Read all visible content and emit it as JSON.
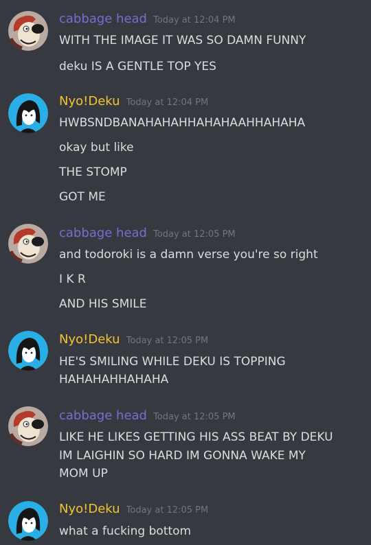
{
  "colors": {
    "background": "#36393f",
    "cabbage_name": "#7d6bd1",
    "deku_name": "#f4c430",
    "timestamp": "#72767d",
    "text": "#dcddde"
  },
  "groups": [
    {
      "author": "cabbage head",
      "avatar": "cartoon-dog-avatar",
      "timestamp": "Today at 12:04 PM",
      "lines": [
        "WITH THE IMAGE IT WAS SO DAMN FUNNY",
        "deku IS A GENTLE TOP YES"
      ]
    },
    {
      "author": "Nyo!Deku",
      "avatar": "anime-girl-avatar",
      "timestamp": "Today at 12:04 PM",
      "lines": [
        "HWBSNDBANAHAHAHHAHAHAAHHAHAHA",
        "okay but like",
        "THE STOMP",
        "GOT ME"
      ]
    },
    {
      "author": "cabbage head",
      "avatar": "cartoon-dog-avatar",
      "timestamp": "Today at 12:05 PM",
      "lines": [
        "and todoroki is a damn verse you're so right",
        "I K R",
        "AND HIS SMILE"
      ]
    },
    {
      "author": "Nyo!Deku",
      "avatar": "anime-girl-avatar",
      "timestamp": "Today at 12:05 PM",
      "lines": [
        "HE'S SMILING WHILE DEKU IS TOPPING",
        "HAHAHAHHAHAHA"
      ]
    },
    {
      "author": "cabbage head",
      "avatar": "cartoon-dog-avatar",
      "timestamp": "Today at 12:05 PM",
      "lines": [
        "LIKE HE LIKES GETTING HIS ASS BEAT BY DEKU",
        "IM LAIGHIN SO HARD IM GONNA WAKE MY",
        "MOM UP"
      ]
    },
    {
      "author": "Nyo!Deku",
      "avatar": "anime-girl-avatar",
      "timestamp": "Today at 12:05 PM",
      "lines": [
        "what a fucking bottom"
      ]
    }
  ]
}
